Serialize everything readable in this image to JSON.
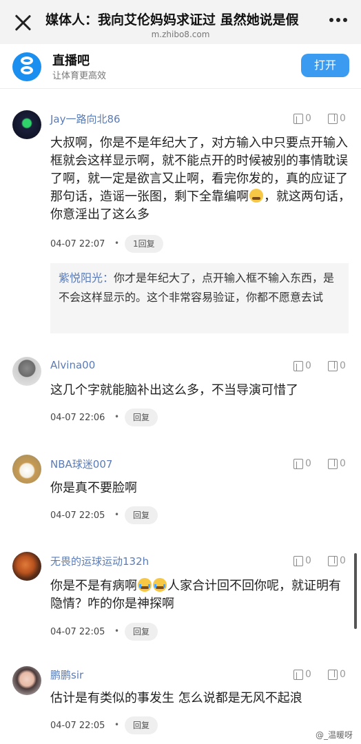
{
  "header": {
    "title": "媒体人：我向艾伦妈妈求证过 虽然她说是假",
    "url": "m.zhibo8.com"
  },
  "app_banner": {
    "name": "直播吧",
    "slogan": "让体育更高效",
    "open_label": "打开"
  },
  "comments": [
    {
      "username": "Jay一路向北86",
      "likes": "0",
      "dislikes": "0",
      "text_before_emoji": "大叔啊，你是不是年纪大了，对方输入中只要点开输入框就会这样显示啊，就不能点开的时候被别的事情耽误了啊，就一定是欲言又止啊，看完你发的，真的应证了那句话，造谣一张图，剩下全靠编啊",
      "text_after_emoji": "，就这两句话，你意淫出了这么多",
      "time": "04-07 22:07",
      "reply_label": "1回复",
      "sub_reply": {
        "username": "紫悦阳光：",
        "text": "你才是年纪大了，点开输入框不输入东西，是不会这样显示的。这个非常容易验证，你都不愿意去试"
      }
    },
    {
      "username": "Alvina00",
      "likes": "0",
      "dislikes": "0",
      "text": "这几个字就能脑补出这么多，不当导演可惜了",
      "time": "04-07 22:06",
      "reply_label": "回复"
    },
    {
      "username": "NBA球迷007",
      "likes": "0",
      "dislikes": "0",
      "text": "你是真不要脸啊",
      "time": "04-07 22:05",
      "reply_label": "回复"
    },
    {
      "username": "无畏的运球运动132h",
      "likes": "0",
      "dislikes": "0",
      "text_before_emoji": "你是不是有病啊",
      "text_after_emoji": "人家合计回不回你呢，就证明有隐情？咋的你是神探啊",
      "time": "04-07 22:05",
      "reply_label": "回复"
    },
    {
      "username": "鹏鹏sir",
      "likes": "0",
      "dislikes": "0",
      "text": "估计是有类似的事发生 怎么说都是无风不起浪",
      "time": "04-07 22:05",
      "reply_label": "回复"
    }
  ],
  "watermark": "@_温暖呀",
  "colors": {
    "accent_blue": "#3a9bf0",
    "username_blue": "#5a7bb5"
  }
}
